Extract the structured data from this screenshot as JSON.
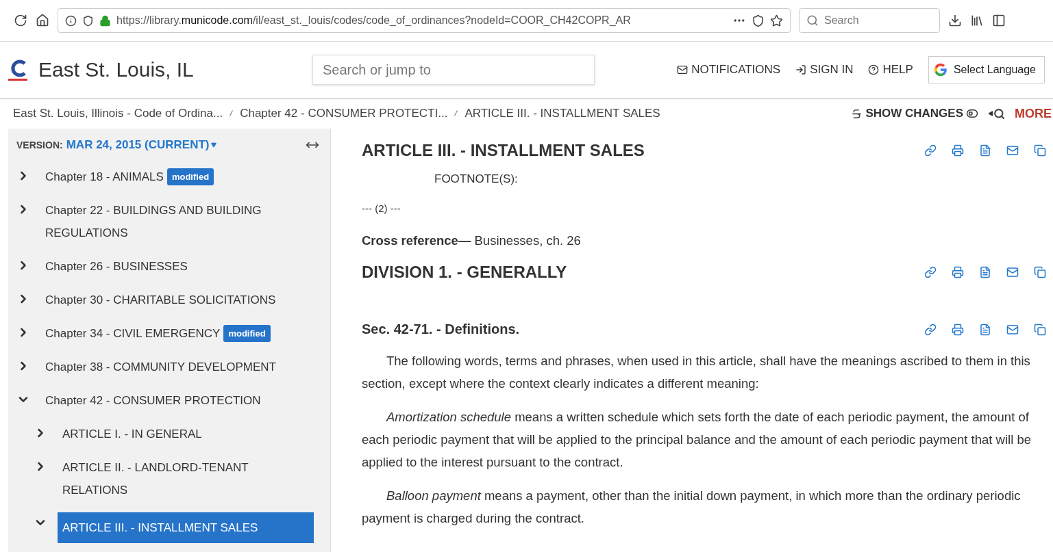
{
  "browser": {
    "url_prefix": "https://library.",
    "url_domain": "municode.com",
    "url_path": "/il/east_st._louis/codes/code_of_ordinances?nodeId=COOR_CH42COPR_AR",
    "search_placeholder": "Search"
  },
  "header": {
    "site_title": "East St. Louis, IL",
    "search_placeholder": "Search or jump to",
    "nav": [
      "NOTIFICATIONS",
      "SIGN IN",
      "HELP"
    ],
    "language": "Select Language"
  },
  "breadcrumbs": [
    "East St. Louis, Illinois - Code of Ordina...",
    "Chapter 42 - CONSUMER PROTECTI...",
    "ARTICLE III. - INSTALLMENT SALES"
  ],
  "toolbar": {
    "show_changes": "SHOW CHANGES",
    "more": "MORE"
  },
  "sidebar": {
    "version_label": "VERSION:",
    "version": "MAR 24, 2015 (CURRENT)",
    "items": [
      {
        "label": "Chapter 18 - ANIMALS",
        "badge": "modified",
        "expanded": false,
        "selected": false
      },
      {
        "label": "Chapter 22 - BUILDINGS AND BUILDING REGULATIONS",
        "expanded": false,
        "selected": false
      },
      {
        "label": "Chapter 26 - BUSINESSES",
        "expanded": false,
        "selected": false
      },
      {
        "label": "Chapter 30 - CHARITABLE SOLICITATIONS",
        "expanded": false,
        "selected": false
      },
      {
        "label": "Chapter 34 - CIVIL EMERGENCY",
        "badge": "modified",
        "expanded": false,
        "selected": false
      },
      {
        "label": "Chapter 38 - COMMUNITY DEVELOPMENT",
        "expanded": false,
        "selected": false
      },
      {
        "label": "Chapter 42 - CONSUMER PROTECTION",
        "expanded": true,
        "selected": false,
        "children": [
          {
            "label": "ARTICLE I. - IN GENERAL",
            "expanded": false,
            "selected": false
          },
          {
            "label": "ARTICLE II. - LANDLORD-TENANT RELATIONS",
            "expanded": false,
            "selected": false
          },
          {
            "label": "ARTICLE III. - INSTALLMENT SALES",
            "expanded": true,
            "selected": true
          }
        ]
      }
    ]
  },
  "content": [
    {
      "kind": "heading",
      "text": "ARTICLE III. - INSTALLMENT SALES"
    },
    {
      "kind": "footnote",
      "text": "FOOTNOTE(S):"
    },
    {
      "kind": "small",
      "text": "--- (2) ---"
    },
    {
      "kind": "paragraph",
      "text": "**Cross reference—** Businesses, ch. 26"
    },
    {
      "kind": "heading",
      "text": "DIVISION 1. - GENERALLY"
    },
    {
      "kind": "section",
      "text": "Sec. 42-71. - Definitions."
    },
    {
      "kind": "indented",
      "text": "The following words, terms and phrases, when used in this article, shall have the meanings ascribed to them in this section, except where the context clearly indicates a different meaning:"
    },
    {
      "kind": "indented",
      "text": "*Amortization schedule* means a written schedule which sets forth the date of each periodic payment, the amount of each periodic payment that will be applied to the principal balance and the amount of each periodic payment that will be applied to the interest pursuant to the contract."
    },
    {
      "kind": "indented",
      "text": "*Balloon payment* means a payment, other than the initial down payment, in which more than the ordinary periodic payment is charged during the contract."
    }
  ]
}
